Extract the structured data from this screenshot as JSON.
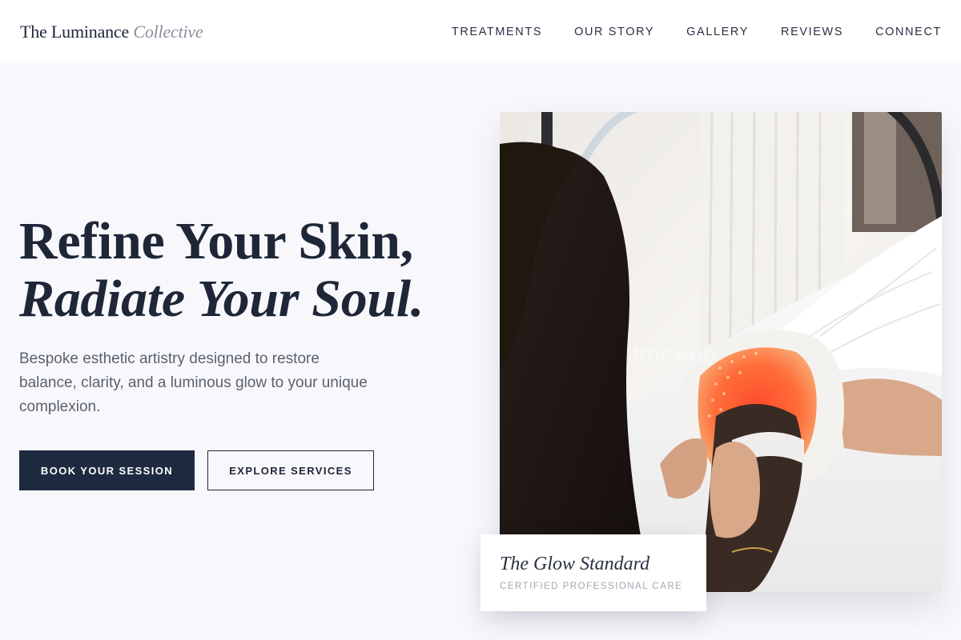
{
  "brand": {
    "name": "The Luminance",
    "name_italic": "Collective"
  },
  "nav": {
    "items": [
      {
        "label": "TREATMENTS"
      },
      {
        "label": "OUR STORY"
      },
      {
        "label": "GALLERY"
      },
      {
        "label": "REVIEWS"
      },
      {
        "label": "CONNECT"
      }
    ]
  },
  "hero": {
    "headline_line1": "Refine Your Skin,",
    "headline_line2": "Radiate Your Soul.",
    "subtext": "Bespoke esthetic artistry designed to restore balance, clarity, and a luminous glow to your unique complexion.",
    "primary_button": "BOOK YOUR SESSION",
    "secondary_button": "EXPLORE SERVICES",
    "image_alt": "LED light therapy facial treatment",
    "watermark": "freeweb"
  },
  "badge": {
    "title": "The Glow Standard",
    "subtitle": "CERTIFIED PROFESSIONAL CARE"
  },
  "colors": {
    "navy": "#1e2a40",
    "background": "#f8f8fc",
    "muted": "#a0a6b2",
    "led_glow": "#ff5a2e"
  }
}
